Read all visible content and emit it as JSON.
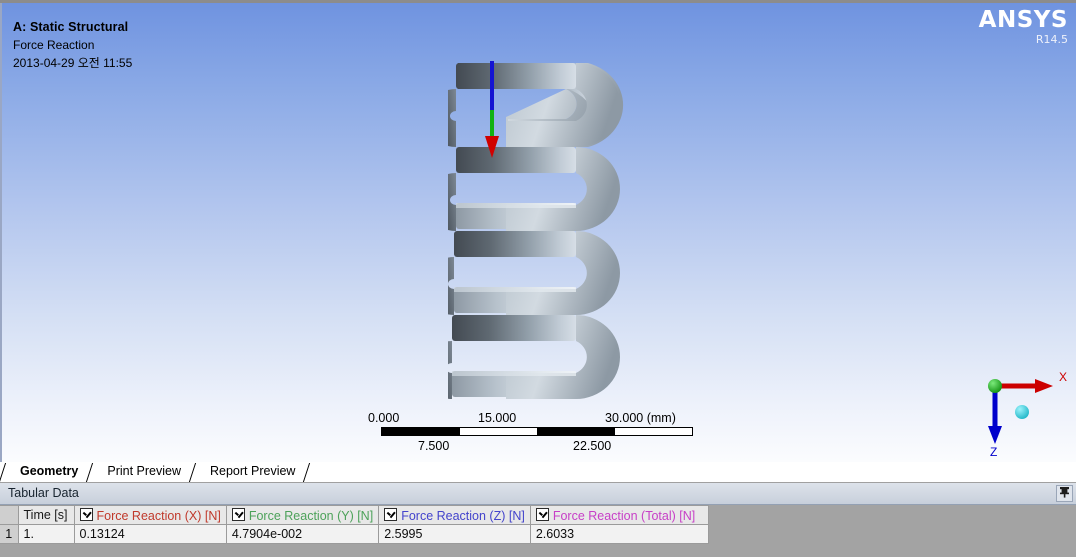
{
  "viewport": {
    "header": {
      "title": "A: Static Structural",
      "subtitle": "Force Reaction",
      "date": "2013-04-29 오전 11:55"
    },
    "logo": {
      "word": "ANSYS",
      "revision": "R14.5"
    },
    "background_top_color": "#6f93e0",
    "background_bottom_color": "#fbfcfe",
    "model": {
      "name": "helical-compression-spring",
      "material_color": "#b9c4ce"
    },
    "force_arrow": {
      "name": "force-reaction-vector"
    },
    "scale_ruler": {
      "top_labels": [
        "0.000",
        "15.000",
        "30.000 (mm)"
      ],
      "bottom_labels": [
        "7.500",
        "22.500"
      ]
    },
    "triad": {
      "x_label": "X",
      "z_label": "Z",
      "x_color": "#cc0000",
      "z_color": "#0000cc",
      "origin_color": "#18a018",
      "ball_color": "#2ec8d8"
    }
  },
  "tabs": [
    {
      "label": "Geometry",
      "active": true
    },
    {
      "label": "Print Preview",
      "active": false
    },
    {
      "label": "Report Preview",
      "active": false
    }
  ],
  "panel": {
    "title": "Tabular Data",
    "pin_icon": "⇱"
  },
  "table": {
    "columns": [
      {
        "label": "Time [s]",
        "checkbox": false,
        "color": "#1a1a1a"
      },
      {
        "label": "Force Reaction (X) [N]",
        "checkbox": true,
        "color": "#c0392b"
      },
      {
        "label": "Force Reaction (Y) [N]",
        "checkbox": true,
        "color": "#4da25a"
      },
      {
        "label": "Force Reaction (Z) [N]",
        "checkbox": true,
        "color": "#4444cc"
      },
      {
        "label": "Force Reaction (Total) [N]",
        "checkbox": true,
        "color": "#c73fc7"
      }
    ],
    "rows": [
      {
        "index": "1",
        "time": "1.",
        "fx": "0.13124",
        "fy": "4.7904e-002",
        "fz": "2.5995",
        "ftotal": "2.6033"
      }
    ]
  }
}
